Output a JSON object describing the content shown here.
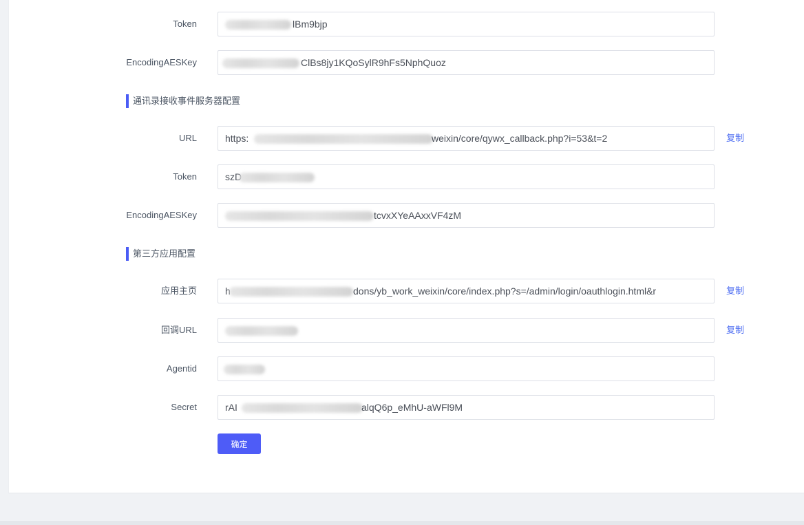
{
  "form": {
    "token_1": {
      "label": "Token",
      "value": "lBm9bjp"
    },
    "aeskey_1": {
      "label": "EncodingAESKey",
      "value": "ClBs8jy1KQoSylR9hFs5NphQuoz"
    },
    "section_contacts": {
      "title": "通讯录接收事件服务器配置"
    },
    "url_2": {
      "label": "URL",
      "value_prefix": "https:",
      "value_suffix": "weixin/core/qywx_callback.php?i=53&t=2",
      "copy_label": "复制"
    },
    "token_2": {
      "label": "Token",
      "value": "szD"
    },
    "aeskey_2": {
      "label": "EncodingAESKey",
      "value": "tcvxXYeAAxxVF4zM"
    },
    "section_thirdparty": {
      "title": "第三方应用配置"
    },
    "homepage": {
      "label": "应用主页",
      "value_prefix": "h",
      "value_suffix": "dons/yb_work_weixin/core/index.php?s=/admin/login/oauthlogin.html&r",
      "copy_label": "复制"
    },
    "callback_url": {
      "label": "回调URL",
      "value": "",
      "copy_label": "复制"
    },
    "agentid": {
      "label": "Agentid",
      "value": ""
    },
    "secret": {
      "label": "Secret",
      "value_prefix": "rAI",
      "value_suffix": "alqQ6p_eMhU-aWFl9M"
    },
    "submit_label": "确定"
  },
  "colors": {
    "accent": "#4e5cf7",
    "link": "#4e6ef2",
    "section_bar": "#4a5cf5",
    "background": "#f0f2f5"
  }
}
